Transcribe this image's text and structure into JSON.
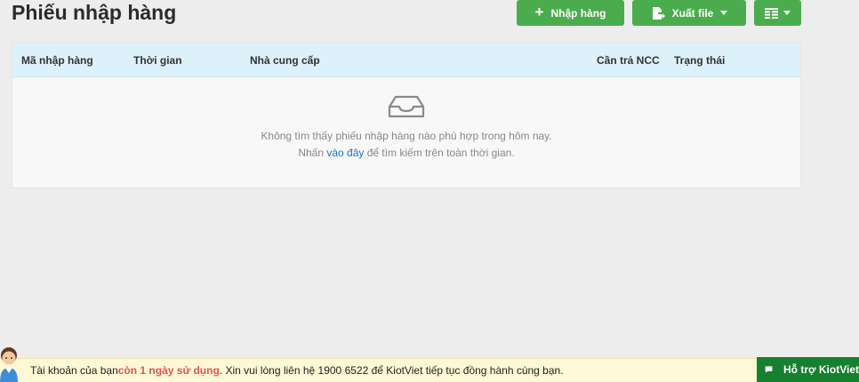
{
  "page": {
    "title": "Phiếu nhập hàng"
  },
  "toolbar": {
    "import_label": "Nhập hàng",
    "export_label": "Xuất file"
  },
  "table": {
    "columns": [
      "Mã nhập hàng",
      "Thời gian",
      "Nhà cung cấp",
      "Cần trả NCC",
      "Trạng thái"
    ],
    "empty_message": "Không tìm thấy phiếu nhập hàng nào phù hợp trong hôm nay.",
    "empty_hint_before": "Nhấn ",
    "empty_hint_link": "vào đây",
    "empty_hint_after": " để tìm kiếm trên toàn thời gian."
  },
  "notice": {
    "prefix": "Tài khoản của bạn ",
    "highlight": "còn 1 ngày sử dụng",
    "suffix": ". Xin vui lòng liên hệ 1900 6522 để KiotViet tiếp tục đồng hành cùng bạn."
  },
  "support": {
    "label": "Hỗ trợ KiotViet"
  },
  "colors": {
    "primary_green": "#4bac4d",
    "header_blue": "#ddf1fa",
    "support_green": "#16802f",
    "warning_red": "#e0564e",
    "link_blue": "#1a73c8"
  },
  "icons": [
    "plus-icon",
    "file-export-icon",
    "column-list-icon",
    "empty-inbox-icon",
    "chat-icon",
    "avatar-icon"
  ]
}
